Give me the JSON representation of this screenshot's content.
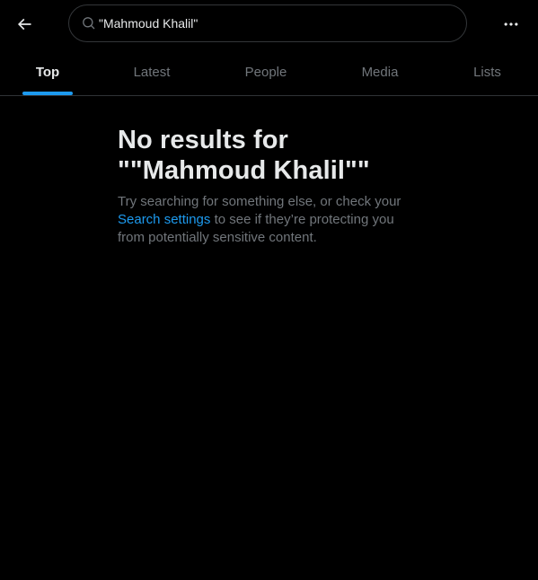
{
  "search": {
    "query": "\"Mahmoud Khalil\""
  },
  "tabs": [
    {
      "label": "Top",
      "active": true
    },
    {
      "label": "Latest",
      "active": false
    },
    {
      "label": "People",
      "active": false
    },
    {
      "label": "Media",
      "active": false
    },
    {
      "label": "Lists",
      "active": false
    }
  ],
  "empty_state": {
    "title_line1": "No results for",
    "title_line2": "\"\"Mahmoud Khalil\"\"",
    "desc_before": "Try searching for something else, or check your",
    "link_text": "Search settings",
    "desc_after": "to see if they’re protecting you from potentially sensitive content."
  },
  "icons": {
    "back": "back-arrow-icon",
    "search": "search-icon",
    "more": "more-horizontal-icon"
  },
  "colors": {
    "background": "#000000",
    "text_primary": "#e7e9ea",
    "text_secondary": "#71767b",
    "accent": "#1d9bf0",
    "border": "#2f3336"
  }
}
